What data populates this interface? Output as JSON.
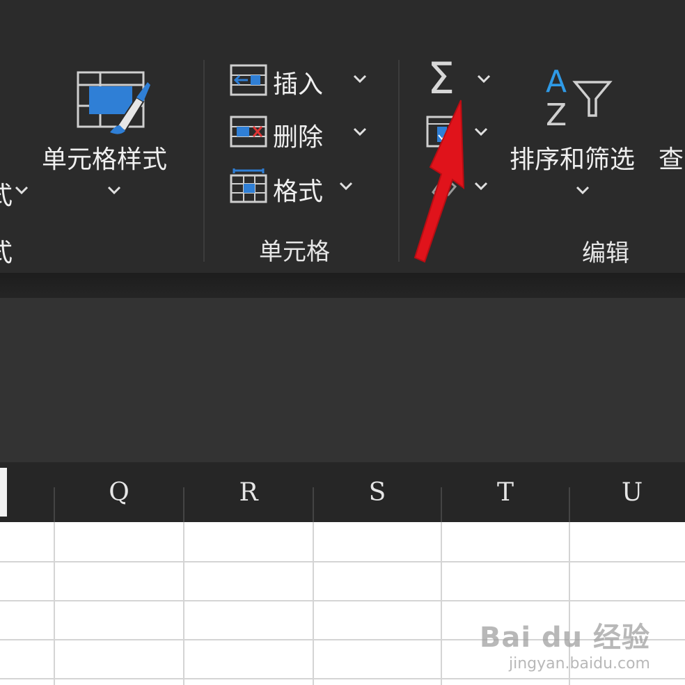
{
  "ribbon": {
    "partial_left_label_1": "式",
    "partial_left_label_2": "式",
    "cell_styles_label": "单元格样式",
    "insert_label": "插入",
    "delete_label": "删除",
    "format_label": "格式",
    "cells_group_label": "单元格",
    "sort_filter_label": "排序和筛选",
    "find_partial_label": "查",
    "editing_group_label": "编辑",
    "sort_icon_letters": {
      "top": "A",
      "bottom": "Z"
    },
    "sum_symbol": "Σ"
  },
  "grid": {
    "columns": [
      "Q",
      "R",
      "S",
      "T",
      "U"
    ]
  },
  "watermark": {
    "main": "Bai du 经验",
    "sub": "jingyan.baidu.com"
  },
  "colors": {
    "ribbon_bg": "#2b2b2b",
    "accent_blue": "#2f7fd6",
    "arrow_red": "#e0131b"
  }
}
